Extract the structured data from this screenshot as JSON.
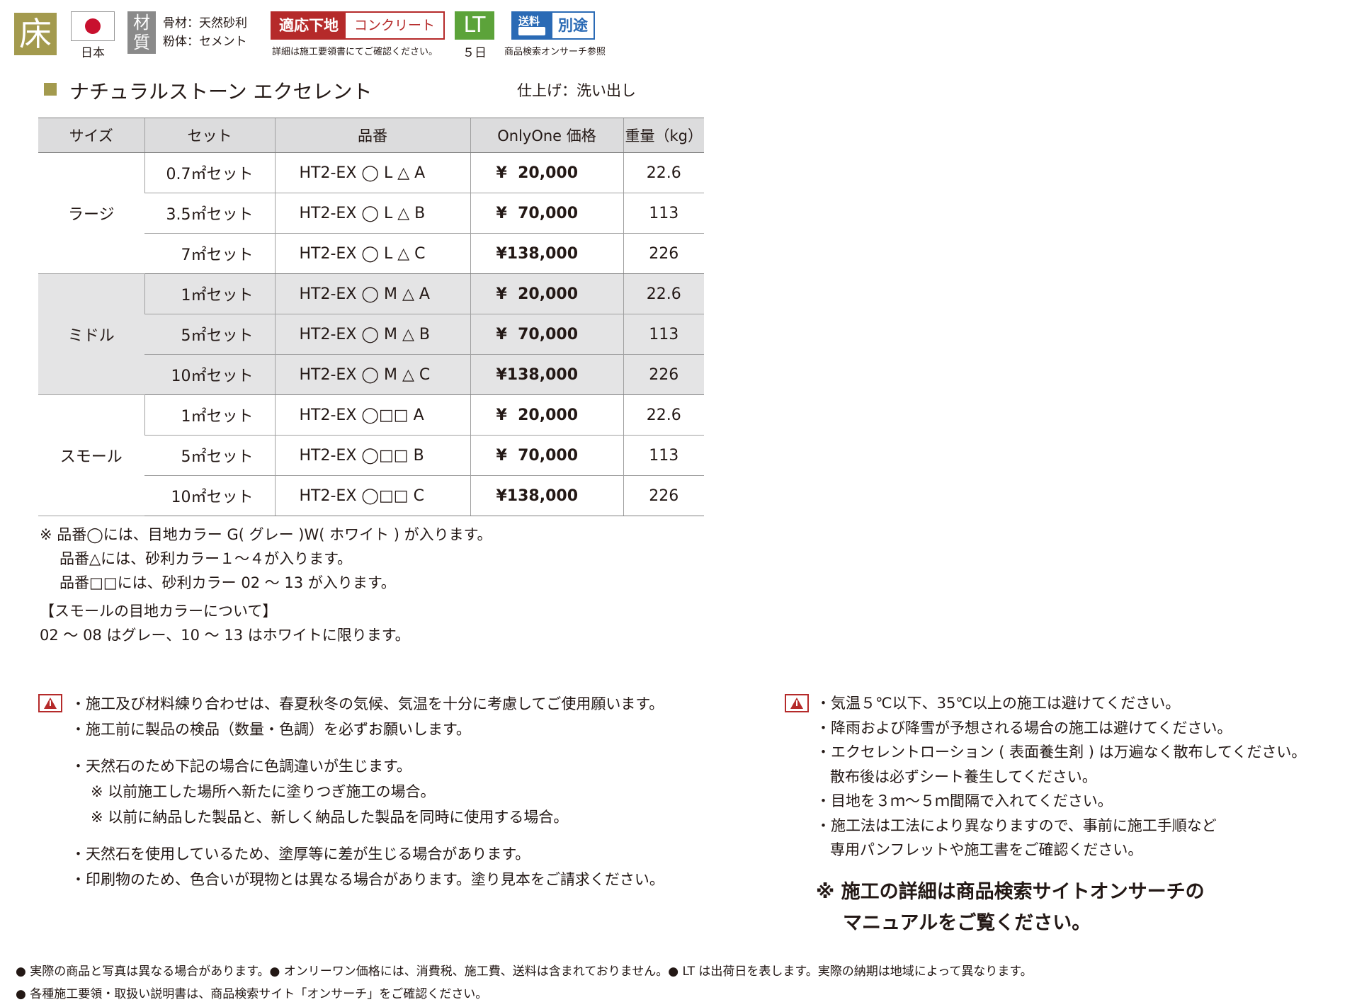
{
  "header": {
    "floor_glyph": "床",
    "country": "日本",
    "material_glyph": "材質",
    "material_lines": [
      "骨材：天然砂利",
      "粉体：セメント"
    ],
    "substrate_label": "適応下地",
    "substrate_value": "コンクリート",
    "substrate_note": "詳細は施工要領書にてご確認ください。",
    "lt_label": "LT",
    "lt_days": "５日",
    "shipping_label": "送料",
    "shipping_value": "別途",
    "shipping_note": "商品検索オンサーチ参照",
    "colors": {
      "brand_olive": "#a39a4e",
      "red": "#b52a2a",
      "green": "#5ca33a",
      "blue": "#2a6ab5"
    }
  },
  "product": {
    "title": "ナチュラルストーン エクセレント",
    "finish": "仕上げ：洗い出し"
  },
  "table": {
    "headers": [
      "サイズ",
      "セット",
      "品番",
      "OnlyOne 価格",
      "重量（kg）"
    ],
    "groups": [
      {
        "size": "ラージ",
        "shaded": false,
        "rows": [
          {
            "set": "0.7㎡セット",
            "code": "HT2-EX ◯ L △ A",
            "price": "¥  20,000",
            "weight": "22.6"
          },
          {
            "set": "3.5㎡セット",
            "code": "HT2-EX ◯ L △ B",
            "price": "¥  70,000",
            "weight": "113"
          },
          {
            "set": "7㎡セット",
            "code": "HT2-EX ◯ L △ C",
            "price": "¥138,000",
            "weight": "226"
          }
        ]
      },
      {
        "size": "ミドル",
        "shaded": true,
        "rows": [
          {
            "set": "1㎡セット",
            "code": "HT2-EX ◯ M △ A",
            "price": "¥  20,000",
            "weight": "22.6"
          },
          {
            "set": "5㎡セット",
            "code": "HT2-EX ◯ M △ B",
            "price": "¥  70,000",
            "weight": "113"
          },
          {
            "set": "10㎡セット",
            "code": "HT2-EX ◯ M △ C",
            "price": "¥138,000",
            "weight": "226"
          }
        ]
      },
      {
        "size": "スモール",
        "shaded": false,
        "rows": [
          {
            "set": "1㎡セット",
            "code": "HT2-EX ◯□□ A",
            "price": "¥  20,000",
            "weight": "22.6"
          },
          {
            "set": "5㎡セット",
            "code": "HT2-EX ◯□□ B",
            "price": "¥  70,000",
            "weight": "113"
          },
          {
            "set": "10㎡セット",
            "code": "HT2-EX ◯□□ C",
            "price": "¥138,000",
            "weight": "226"
          }
        ]
      }
    ]
  },
  "notes": {
    "lines": [
      "※ 品番◯には、目地カラー G( グレー )W( ホワイト ) が入ります。",
      "品番△には、砂利カラー１～４が入ります。",
      "品番□□には、砂利カラー 02 ～ 13 が入ります。"
    ],
    "small_head": "【スモールの目地カラーについて】",
    "small_body": " 02 ～ 08 はグレー、10 ～ 13 はホワイトに限ります。"
  },
  "cautions_left": [
    "・施工及び材料練り合わせは、春夏秋冬の気候、気温を十分に考慮してご使用願います。",
    "・施工前に製品の検品（数量・色調）を必ずお願いします。",
    "・天然石のため下記の場合に色調違いが生じます。",
    "※ 以前施工した場所へ新たに塗りつぎ施工の場合。",
    "※ 以前に納品した製品と、新しく納品した製品を同時に使用する場合。",
    "・天然石を使用しているため、塗厚等に差が生じる場合があります。",
    "・印刷物のため、色合いが現物とは異なる場合があります。塗り見本をご請求ください。"
  ],
  "cautions_right": [
    "・気温５℃以下、35℃以上の施工は避けてください。",
    "・降雨および降雪が予想される場合の施工は避けてください。",
    "・エクセレントローション ( 表面養生剤 ) は万遍なく散布してください。",
    "散布後は必ずシート養生してください。",
    "・目地を３ｍ～５ｍ間隔で入れてください。",
    "・施工法は工法により異なりますので、事前に施工手順など",
    "専用パンフレットや施工書をご確認ください。"
  ],
  "emphasis": [
    "※ 施工の詳細は商品検索サイトオンサーチの",
    "マニュアルをご覧ください。"
  ],
  "footer": [
    "● 実際の商品と写真は異なる場合があります。● オンリーワン価格には、消費税、施工費、送料は含まれておりません。● LT は出荷日を表します。実際の納期は地域によって異なります。",
    "● 各種施工要領・取扱い説明書は、商品検索サイト「オンサーチ」をご確認ください。"
  ]
}
